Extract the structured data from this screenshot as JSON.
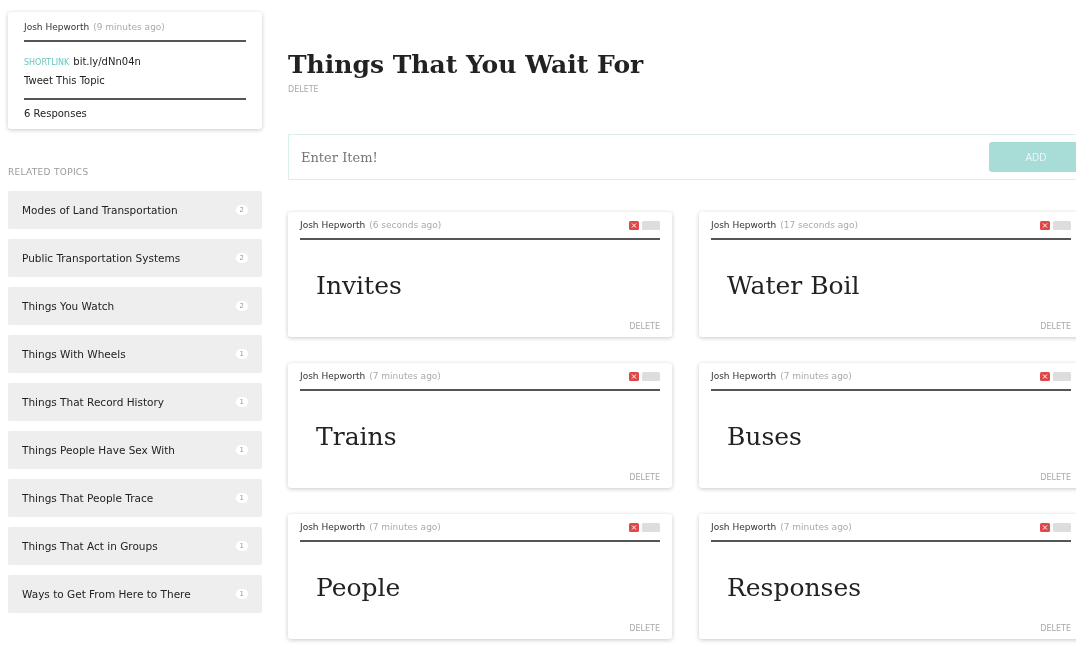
{
  "topic_card": {
    "author": "Josh Hepworth",
    "time": "(9 minutes ago)",
    "shortlink_label": "SHORTLINK",
    "shortlink": "bit.ly/dNn04n",
    "tweet": "Tweet This Topic",
    "responses": "6 Responses"
  },
  "related_heading": "RELATED TOPICS",
  "related_topics": [
    {
      "label": "Modes of Land Transportation",
      "count": "2"
    },
    {
      "label": "Public Transportation Systems",
      "count": "2"
    },
    {
      "label": "Things You Watch",
      "count": "2"
    },
    {
      "label": "Things With Wheels",
      "count": "1"
    },
    {
      "label": "Things That Record History",
      "count": "1"
    },
    {
      "label": "Things People Have Sex With",
      "count": "1"
    },
    {
      "label": "Things That People Trace",
      "count": "1"
    },
    {
      "label": "Things That Act in Groups",
      "count": "1"
    },
    {
      "label": "Ways to Get From Here to There",
      "count": "1"
    }
  ],
  "title": "Things That You Wait For",
  "title_delete": "DELETE",
  "entry": {
    "placeholder": "Enter Item!",
    "button": "ADD"
  },
  "items": [
    {
      "author": "Josh Hepworth",
      "time": "(6 seconds ago)",
      "text": "Invites",
      "delete": "DELETE"
    },
    {
      "author": "Josh Hepworth",
      "time": "(17 seconds ago)",
      "text": "Water Boil",
      "delete": "DELETE"
    },
    {
      "author": "Josh Hepworth",
      "time": "(7 minutes ago)",
      "text": "Trains",
      "delete": "DELETE"
    },
    {
      "author": "Josh Hepworth",
      "time": "(7 minutes ago)",
      "text": "Buses",
      "delete": "DELETE"
    },
    {
      "author": "Josh Hepworth",
      "time": "(7 minutes ago)",
      "text": "People",
      "delete": "DELETE"
    },
    {
      "author": "Josh Hepworth",
      "time": "(7 minutes ago)",
      "text": "Responses",
      "delete": "DELETE"
    }
  ]
}
